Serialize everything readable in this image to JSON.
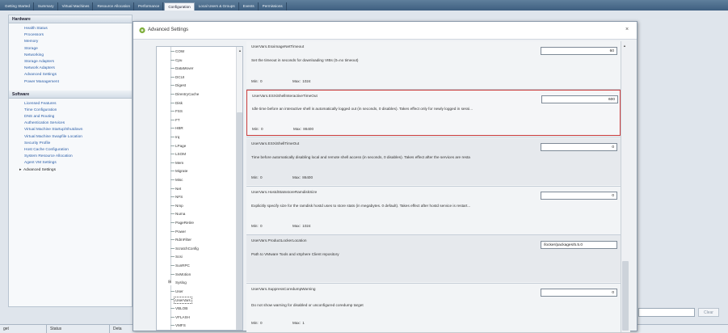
{
  "tabs": [
    "Getting Started",
    "Summary",
    "Virtual Machines",
    "Resource Allocation",
    "Performance",
    "Configuration",
    "Local Users & Groups",
    "Events",
    "Permissions"
  ],
  "active_tab": 5,
  "hardware": {
    "heading": "Hardware",
    "items": [
      "Health Status",
      "Processors",
      "Memory",
      "Storage",
      "Networking",
      "Storage Adapters",
      "Network Adapters",
      "Advanced Settings",
      "Power Management"
    ]
  },
  "software": {
    "heading": "Software",
    "items": [
      "Licensed Features",
      "Time Configuration",
      "DNS and Routing",
      "Authentication Services",
      "Virtual Machine Startup/Shutdown",
      "Virtual Machine Swapfile Location",
      "Security Profile",
      "Host Cache Configuration",
      "System Resource Allocation",
      "Agent VM Settings",
      "Advanced Settings"
    ],
    "selected_index": 10,
    "selected_arrow": "▸"
  },
  "bottom": {
    "columns": [
      "get",
      "Status",
      "Deta"
    ],
    "clear_label": "Clear"
  },
  "dialog": {
    "title": "Advanced Settings",
    "close_glyph": "×",
    "tree": {
      "items": [
        "COW",
        "Cpu",
        "DataMover",
        "DCUI",
        "Digest",
        "DirentryCache",
        "Disk",
        "FSS",
        "FT",
        "HBR",
        "Irq",
        "LPage",
        "LSOM",
        "Mem",
        "Migrate",
        "Misc",
        "Net",
        "NFS",
        "Nmp",
        "Numa",
        "PageRetire",
        "Power",
        "RdmFilter",
        "ScratchConfig",
        "Scsi",
        "SunRPC",
        "SvMotion",
        "Syslog",
        "User",
        "UserVars",
        "VBLOB",
        "VFLASH",
        "VMFS"
      ],
      "expand_glyph": "⊞",
      "expanded_item": "Syslog",
      "selected_item": "UserVars",
      "scroll_up_glyph": "▲"
    },
    "settings": [
      {
        "key": "UserVars.EsximageNetTimeout",
        "desc": "Set the timeout in seconds for downloading VIBs (0=no timeout)",
        "min_label": "Min:",
        "min": "0",
        "max_label": "Max:",
        "max": "1024",
        "value": "60"
      },
      {
        "key": "UserVars.ESXiShellInteractiveTimeOut",
        "desc": "Idle time before an interactive shell is automatically logged out (in seconds, 0 disables). Takes effect only for newly logged in sessi...",
        "min_label": "Min:",
        "min": "0",
        "max_label": "Max:",
        "max": "86400",
        "value": "600"
      },
      {
        "key": "UserVars.ESXiShellTimeOut",
        "desc": "Time before automatically disabling local and remote shell access (in seconds, 0 disables). Takes effect after the services are resta",
        "min_label": "Min:",
        "min": "0",
        "max_label": "Max:",
        "max": "86400",
        "value": "0"
      },
      {
        "key": "UserVars.HostdStatsstoreRamdiskSize",
        "desc": "Explicitly specify size for the ramdisk hostd uses to store stats (in megabytes. 0 default). Takes effect after hostd service is restart...",
        "min_label": "Min:",
        "min": "0",
        "max_label": "Max:",
        "max": "1024",
        "value": "0"
      },
      {
        "key": "UserVars.ProductLockerLocation",
        "desc": "Path to VMware Tools and vSphere Client repository",
        "value": "/locker/packages/5.5.0"
      },
      {
        "key": "UserVars.SuppressCoredumpWarning",
        "desc": "Do not show warning for disabled or unconfigured coredump target",
        "min_label": "Min:",
        "min": "0",
        "max_label": "Max:",
        "max": "1",
        "value": "0"
      }
    ],
    "scroll_up_glyph": "▲"
  },
  "colors": {
    "highlight_border": "#c93b3b",
    "link": "#2b5ea8",
    "tab_bar": "#4a6a8a"
  }
}
